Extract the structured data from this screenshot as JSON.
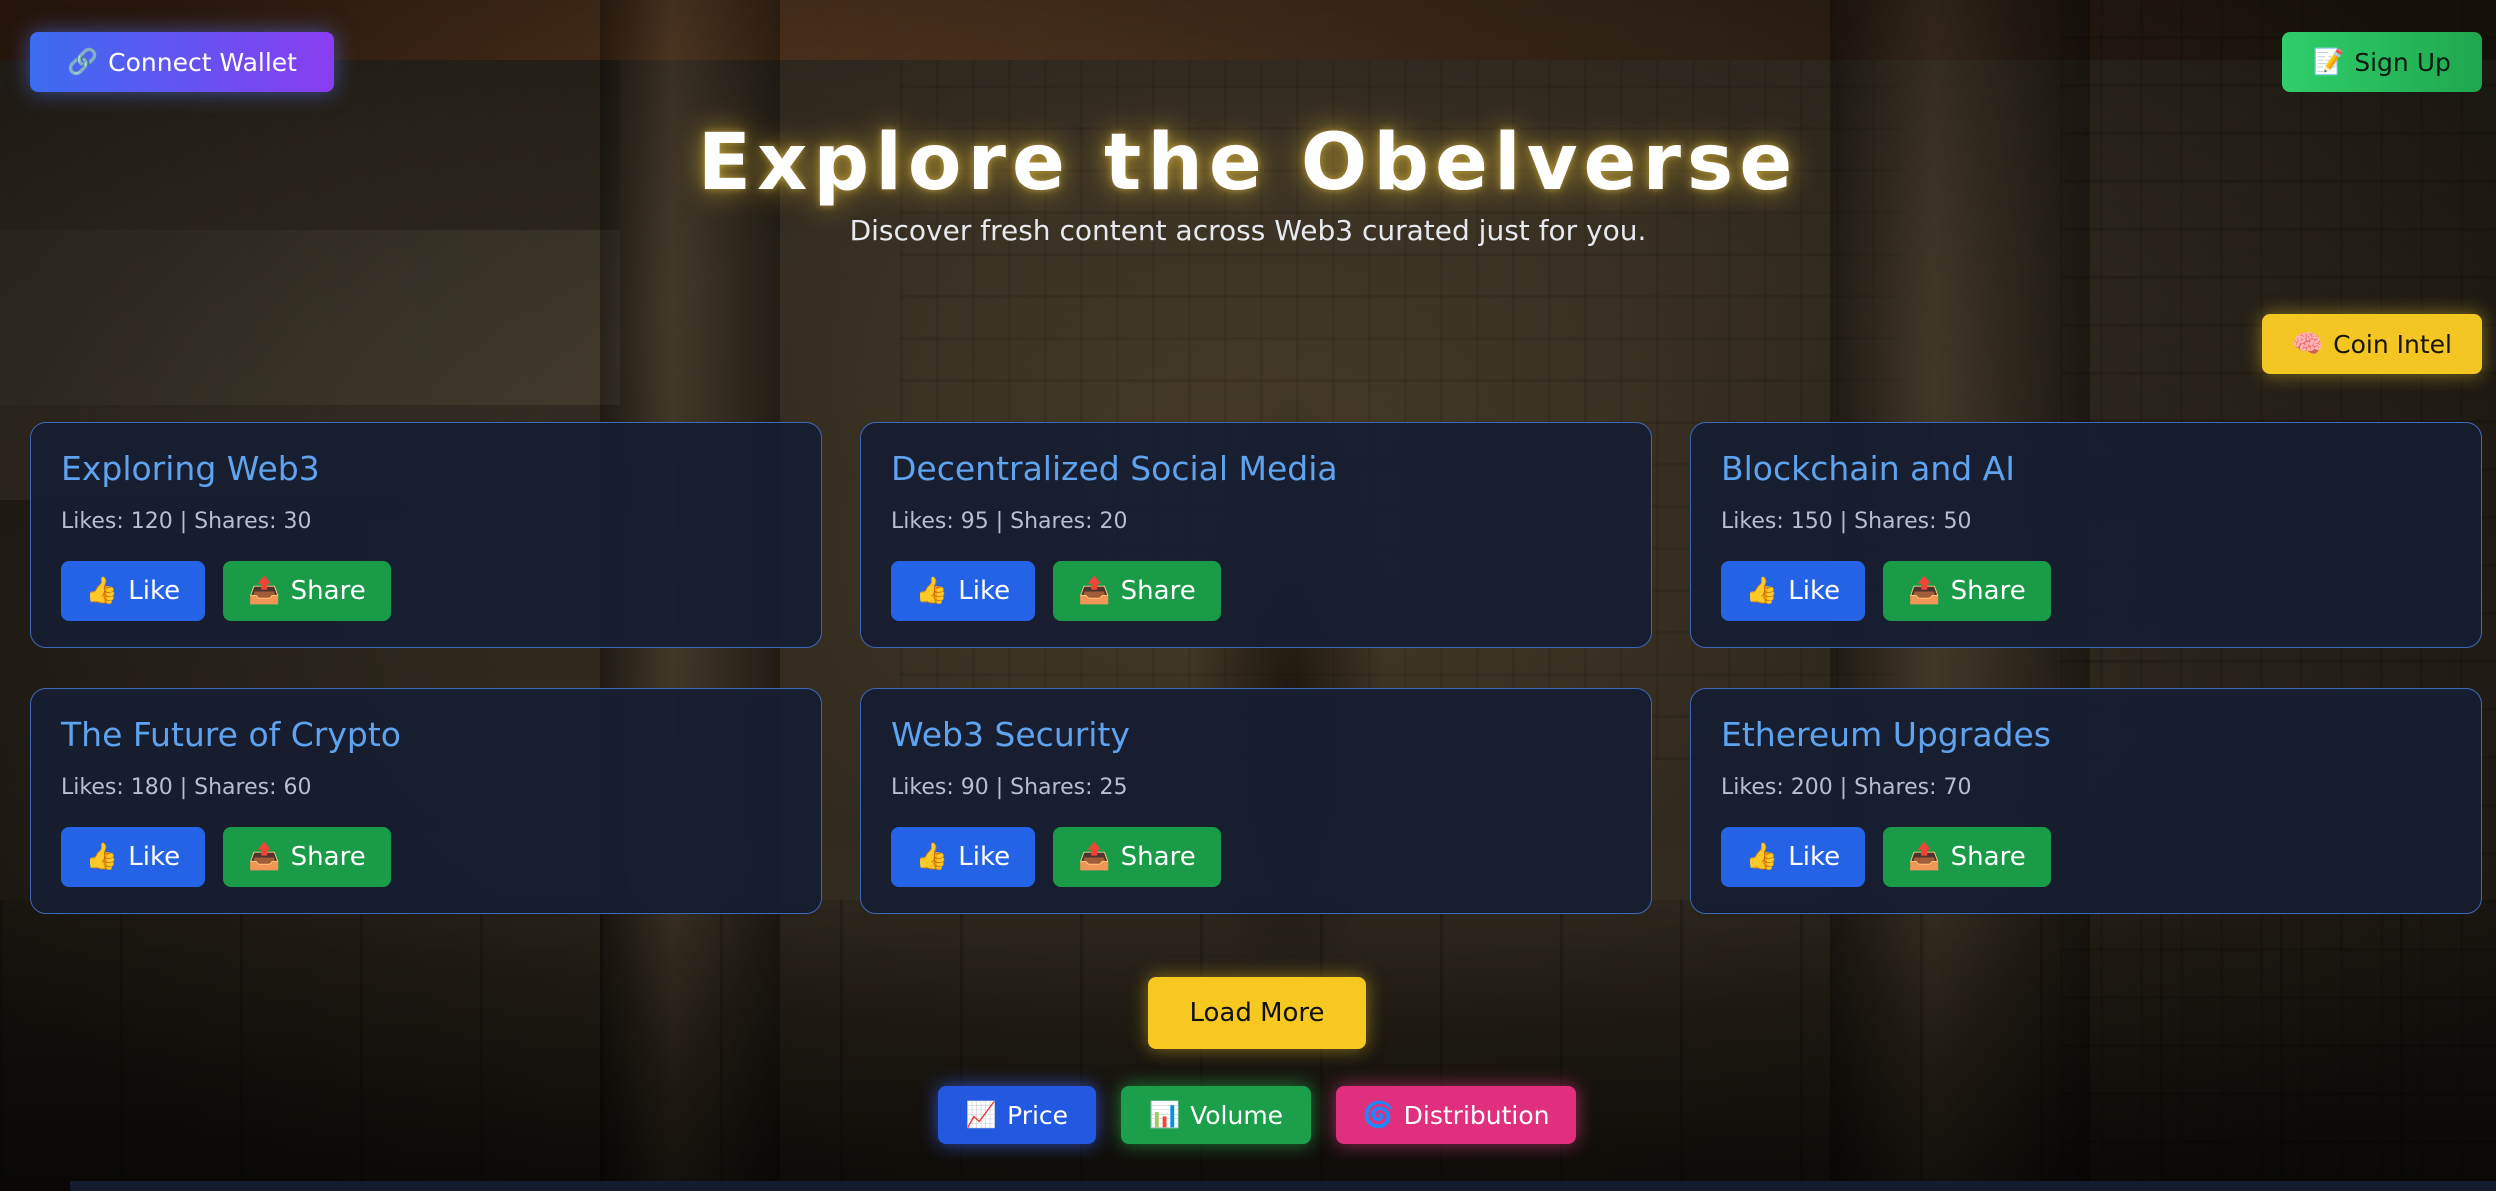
{
  "header": {
    "connect_wallet": {
      "icon": "🔗",
      "label": "Connect Wallet"
    },
    "sign_up": {
      "icon": "📝",
      "label": "Sign Up"
    },
    "coin_intel": {
      "icon": "🧠",
      "label": "Coin Intel"
    }
  },
  "hero": {
    "title": "Explore the Obelverse",
    "subtitle": "Discover fresh content across Web3 curated just for you."
  },
  "cards": [
    {
      "title": "Exploring Web3",
      "stats": "Likes: 120 | Shares: 30"
    },
    {
      "title": "Decentralized Social Media",
      "stats": "Likes: 95 | Shares: 20"
    },
    {
      "title": "Blockchain and AI",
      "stats": "Likes: 150 | Shares: 50"
    },
    {
      "title": "The Future of Crypto",
      "stats": "Likes: 180 | Shares: 60"
    },
    {
      "title": "Web3 Security",
      "stats": "Likes: 90 | Shares: 25"
    },
    {
      "title": "Ethereum Upgrades",
      "stats": "Likes: 200 | Shares: 70"
    }
  ],
  "card_actions": {
    "like": {
      "icon": "👍",
      "label": "Like"
    },
    "share": {
      "icon": "📤",
      "label": "Share"
    }
  },
  "load_more": "Load More",
  "chart_tabs": [
    {
      "icon": "📈",
      "label": "Price"
    },
    {
      "icon": "📊",
      "label": "Volume"
    },
    {
      "icon": "🌀",
      "label": "Distribution"
    }
  ],
  "colors": {
    "accent_blue": "#2563e6",
    "accent_green": "#1a9b48",
    "accent_yellow": "#f6c820",
    "accent_pink": "#e0307d",
    "card_title": "#5fa3ef"
  }
}
